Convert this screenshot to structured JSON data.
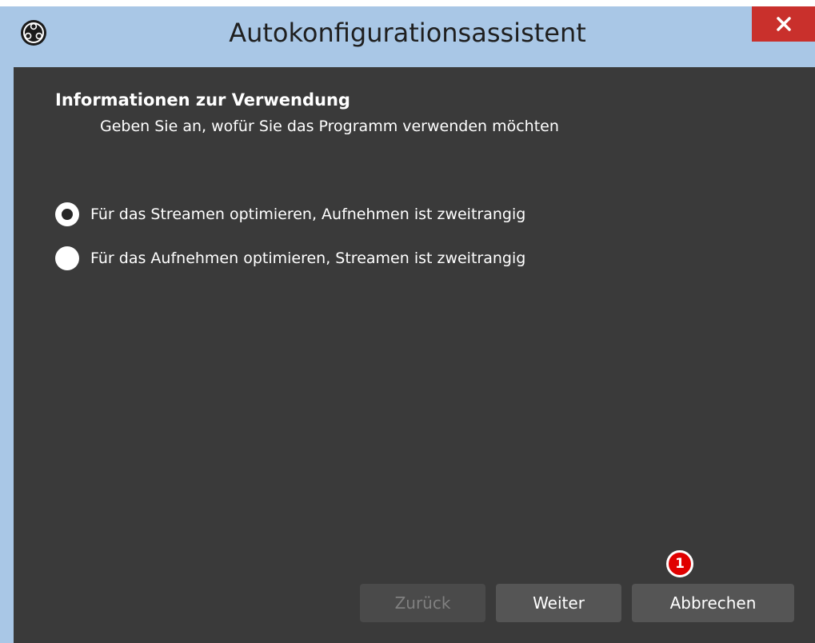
{
  "window": {
    "title": "Autokonfigurationsassistent",
    "app_icon": "obs-logo-icon",
    "close_icon": "close-icon"
  },
  "page": {
    "heading": "Informationen zur Verwendung",
    "subheading": "Geben Sie an, wofür Sie das Programm verwenden möchten"
  },
  "options": [
    {
      "label": "Für das Streamen optimieren, Aufnehmen ist zweitrangig",
      "checked": true
    },
    {
      "label": "Für das Aufnehmen optimieren, Streamen ist zweitrangig",
      "checked": false
    }
  ],
  "buttons": {
    "back": "Zurück",
    "next": "Weiter",
    "cancel": "Abbrechen"
  },
  "annotation": {
    "badge_number": "1",
    "badge_color": "#e00000"
  },
  "colors": {
    "titlebar": "#a9c7e6",
    "content_bg": "#3a3a3a",
    "close_button": "#c9302c"
  }
}
